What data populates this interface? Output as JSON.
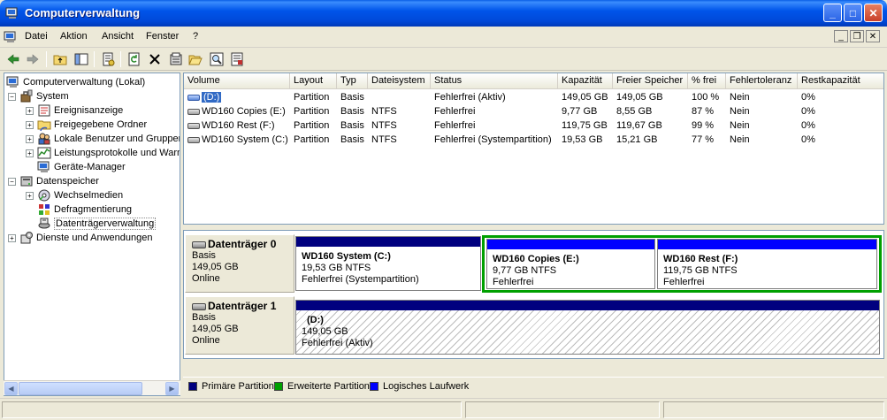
{
  "window": {
    "title": "Computerverwaltung",
    "buttons": {
      "minimize": "_",
      "maximize": "□",
      "close": "✕"
    }
  },
  "menu": {
    "items": [
      "Datei",
      "Aktion",
      "Ansicht",
      "Fenster",
      "?"
    ],
    "mdi_buttons": {
      "minimize": "_",
      "restore": "❐",
      "close": "✕"
    }
  },
  "toolbar": {
    "icons": [
      "back-arrow-icon",
      "forward-arrow-icon",
      "up-folder-icon",
      "show-hide-tree-icon",
      "properties-icon",
      "refresh-icon",
      "delete-icon",
      "settings-icon",
      "open-folder-icon",
      "search-icon",
      "help-icon"
    ]
  },
  "tree": {
    "root": "Computerverwaltung (Lokal)",
    "system": "System",
    "ereignisanzeige": "Ereignisanzeige",
    "freigegebene": "Freigegebene Ordner",
    "lokale_benutzer": "Lokale Benutzer und Gruppen",
    "leistungsprotokolle": "Leistungsprotokolle und Warnungen",
    "geraete": "Geräte-Manager",
    "datenspeicher": "Datenspeicher",
    "wechselmedien": "Wechselmedien",
    "defrag": "Defragmentierung",
    "datentraeger": "Datenträgerverwaltung",
    "dienste": "Dienste und Anwendungen"
  },
  "volumes": {
    "headers": [
      "Volume",
      "Layout",
      "Typ",
      "Dateisystem",
      "Status",
      "Kapazität",
      "Freier Speicher",
      "% frei",
      "Fehlertoleranz",
      "Restkapazität"
    ],
    "rows": [
      {
        "volume": "(D:)",
        "layout": "Partition",
        "typ": "Basis",
        "fs": "",
        "status": "Fehlerfrei (Aktiv)",
        "kap": "149,05 GB",
        "frei": "149,05 GB",
        "pct": "100 %",
        "fehler": "Nein",
        "rest": "0%"
      },
      {
        "volume": "WD160 Copies (E:)",
        "layout": "Partition",
        "typ": "Basis",
        "fs": "NTFS",
        "status": "Fehlerfrei",
        "kap": "9,77 GB",
        "frei": "8,55 GB",
        "pct": "87 %",
        "fehler": "Nein",
        "rest": "0%"
      },
      {
        "volume": "WD160 Rest (F:)",
        "layout": "Partition",
        "typ": "Basis",
        "fs": "NTFS",
        "status": "Fehlerfrei",
        "kap": "119,75 GB",
        "frei": "119,67 GB",
        "pct": "99 %",
        "fehler": "Nein",
        "rest": "0%"
      },
      {
        "volume": "WD160 System (C:)",
        "layout": "Partition",
        "typ": "Basis",
        "fs": "NTFS",
        "status": "Fehlerfrei (Systempartition)",
        "kap": "19,53 GB",
        "frei": "15,21 GB",
        "pct": "77 %",
        "fehler": "Nein",
        "rest": "0%"
      }
    ]
  },
  "disks": {
    "disk0": {
      "name": "Datenträger 0",
      "type": "Basis",
      "size": "149,05 GB",
      "status": "Online",
      "p_c": {
        "name": "WD160 System  (C:)",
        "size": "19,53 GB NTFS",
        "status": "Fehlerfrei (Systempartition)"
      },
      "p_e": {
        "name": "WD160 Copies  (E:)",
        "size": "9,77 GB NTFS",
        "status": "Fehlerfrei"
      },
      "p_f": {
        "name": "WD160 Rest  (F:)",
        "size": "119,75 GB NTFS",
        "status": "Fehlerfrei"
      }
    },
    "disk1": {
      "name": "Datenträger 1",
      "type": "Basis",
      "size": "149,05 GB",
      "status": "Online",
      "p_d": {
        "name": "(D:)",
        "size": "149,05 GB",
        "status": "Fehlerfrei (Aktiv)"
      }
    }
  },
  "legend": {
    "primary": "Primäre Partition",
    "extended": "Erweiterte Partition",
    "logical": "Logisches Laufwerk"
  },
  "colors": {
    "primary": "#00007f",
    "extended": "#00a000",
    "logical": "#0000ff",
    "selection": "#316ac5"
  }
}
